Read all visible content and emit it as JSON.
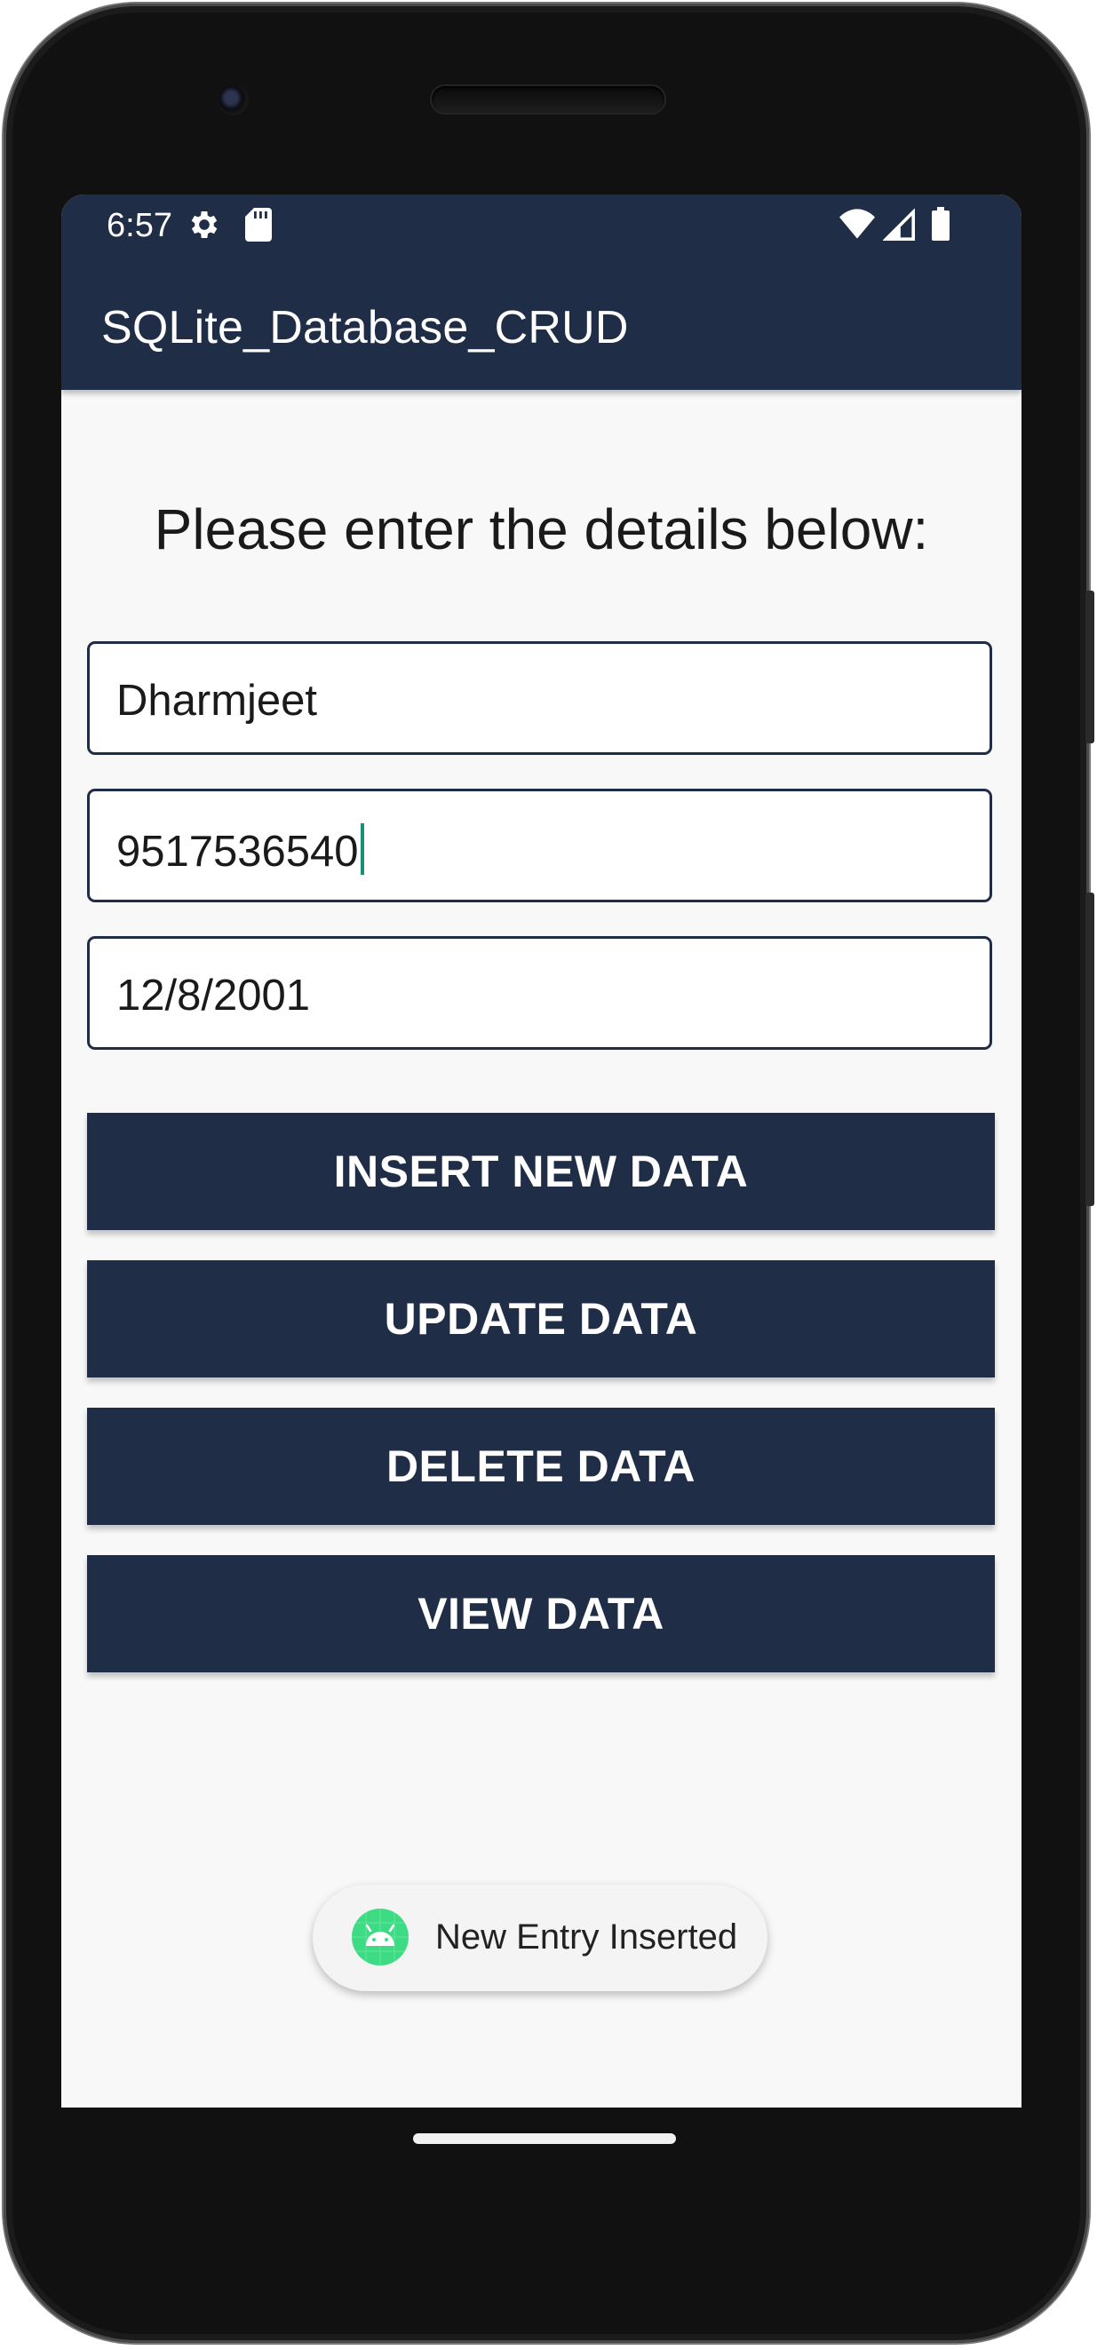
{
  "status_bar": {
    "time": "6:57",
    "icons": [
      "gear-icon",
      "sd-card-icon",
      "wifi-icon",
      "signal-icon",
      "battery-icon"
    ]
  },
  "app_bar": {
    "title": "SQLite_Database_CRUD"
  },
  "main": {
    "heading": "Please enter the details below:",
    "fields": [
      {
        "value": "Dharmjeet"
      },
      {
        "value": "9517536540"
      },
      {
        "value": "12/8/2001"
      }
    ],
    "buttons": [
      {
        "label": "INSERT NEW DATA"
      },
      {
        "label": "UPDATE DATA"
      },
      {
        "label": "DELETE DATA"
      },
      {
        "label": "VIEW DATA"
      }
    ]
  },
  "toast": {
    "message": "New Entry Inserted",
    "icon": "android-icon"
  },
  "colors": {
    "primary": "#1f2d47",
    "background": "#f8f8f8",
    "cursor": "#1a8c7a",
    "android": "#3ddc84"
  }
}
